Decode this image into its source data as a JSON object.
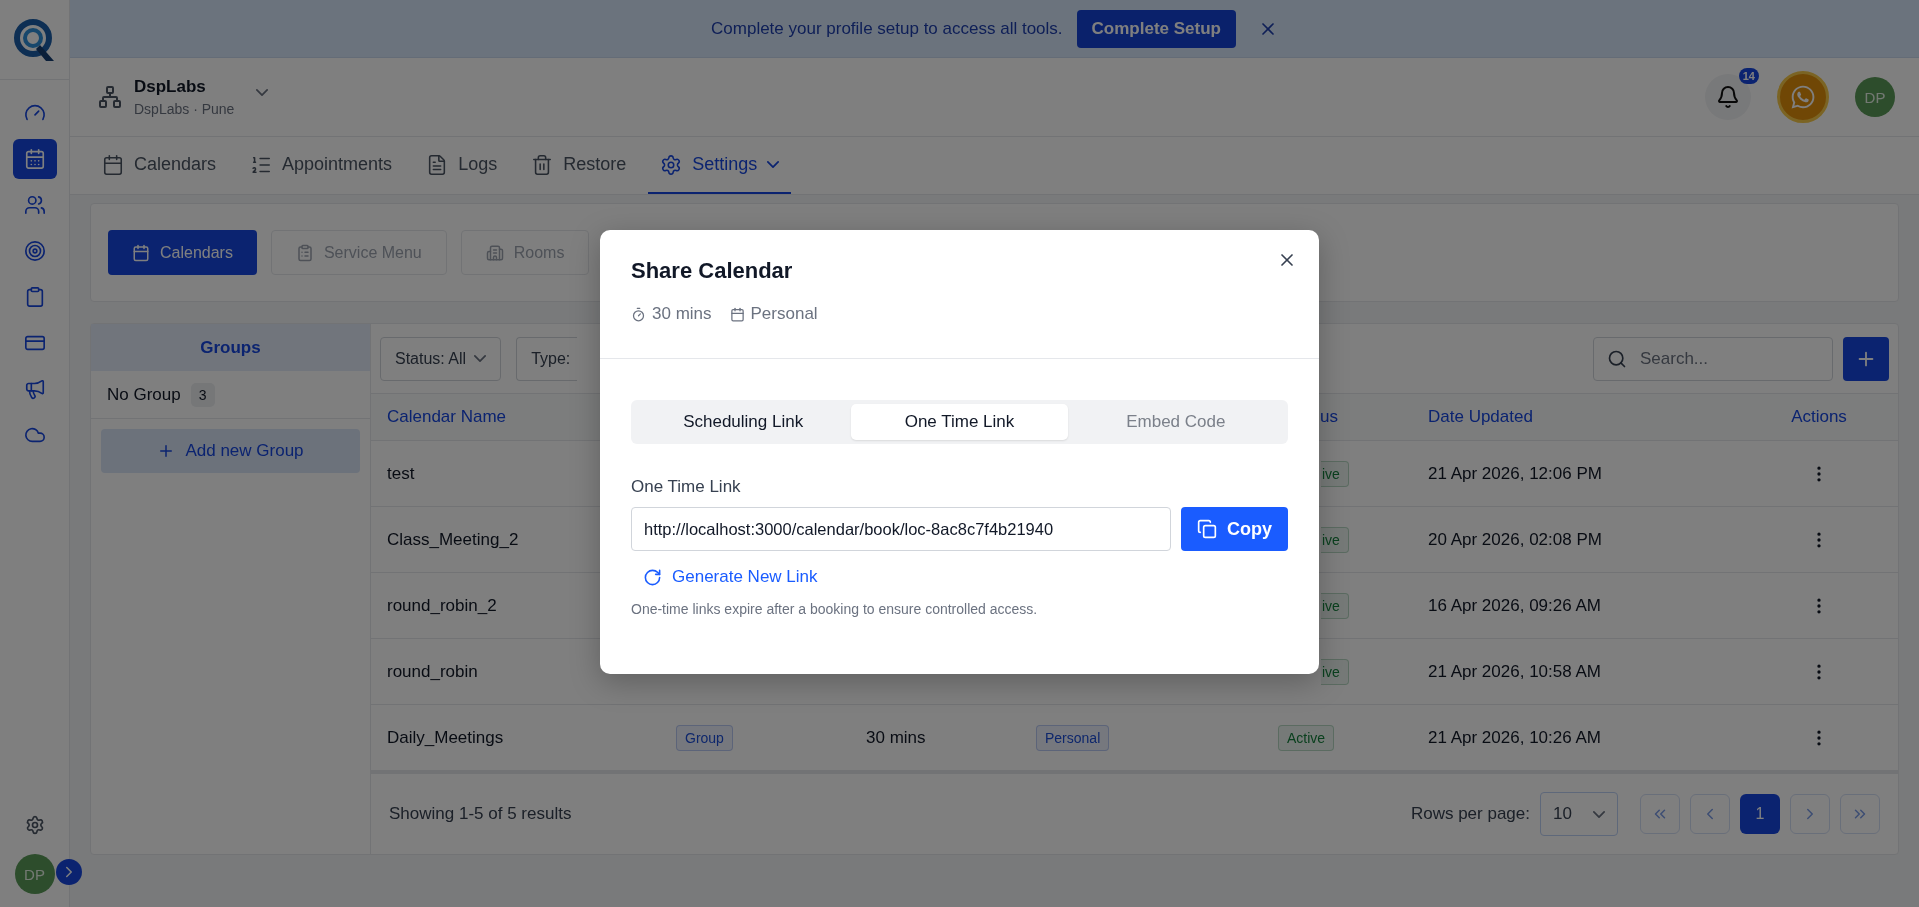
{
  "banner": {
    "message": "Complete your profile setup to access all tools.",
    "button": "Complete Setup"
  },
  "sidebar": {
    "items": [
      {
        "selected": false
      },
      {
        "selected": true
      },
      {
        "selected": false
      },
      {
        "selected": false
      },
      {
        "selected": false
      },
      {
        "selected": false
      },
      {
        "selected": false
      },
      {
        "selected": false
      }
    ],
    "avatar": "DP"
  },
  "org": {
    "name": "DspLabs",
    "location": "DspLabs · Pune"
  },
  "header": {
    "notifications": "14",
    "avatar": "DP"
  },
  "nav_tabs": [
    {
      "label": "Calendars",
      "selected": false
    },
    {
      "label": "Appointments",
      "selected": false
    },
    {
      "label": "Logs",
      "selected": false
    },
    {
      "label": "Restore",
      "selected": false
    },
    {
      "label": "Settings",
      "selected": true
    }
  ],
  "sub_tabs": [
    {
      "label": "Calendars",
      "selected": true
    },
    {
      "label": "Service Menu",
      "selected": false
    },
    {
      "label": "Rooms",
      "selected": false
    }
  ],
  "groups": {
    "title": "Groups",
    "items": [
      {
        "label": "No Group",
        "count": "3"
      }
    ],
    "add_button": "Add new Group"
  },
  "filters": [
    {
      "label": "Status: All"
    },
    {
      "label": "Type:"
    }
  ],
  "search": {
    "placeholder": "Search..."
  },
  "table": {
    "columns": {
      "name": "Calendar Name",
      "status": "us",
      "updated": "Date Updated",
      "actions": "Actions"
    },
    "rows": [
      {
        "kind": "covered",
        "name": "test",
        "status": "ive",
        "updated": "21 Apr 2026, 12:06 PM"
      },
      {
        "kind": "covered",
        "name": "Class_Meeting_2",
        "status": "ive",
        "updated": "20 Apr 2026, 02:08 PM"
      },
      {
        "kind": "covered",
        "name": "round_robin_2",
        "status": "ive",
        "updated": "16 Apr 2026, 09:26 AM"
      },
      {
        "kind": "covered",
        "name": "round_robin",
        "status": "ive",
        "updated": "21 Apr 2026, 10:58 AM"
      },
      {
        "kind": "full",
        "name": "Daily_Meetings",
        "type": "Group",
        "duration": "30 mins",
        "category": "Personal",
        "status": "Active",
        "updated": "21 Apr 2026, 10:26 AM"
      }
    ]
  },
  "footer": {
    "summary": "Showing 1-5 of 5 results",
    "rows_label": "Rows per page:",
    "rows_value": "10",
    "pages": [
      {
        "label": "1",
        "selected": true
      }
    ]
  },
  "modal": {
    "title": "Share Calendar",
    "meta": [
      "30 mins",
      "Personal"
    ],
    "tabs": [
      {
        "label": "Scheduling Link",
        "selected": false,
        "disabled": false
      },
      {
        "label": "One Time Link",
        "selected": true,
        "disabled": false
      },
      {
        "label": "Embed Code",
        "selected": false,
        "disabled": true
      }
    ],
    "link_label": "One Time Link",
    "link_value": "http://localhost:3000/calendar/book/loc-8ac8c7f4b21940",
    "copy_button": "Copy",
    "generate_button": "Generate New Link",
    "note": "One-time links expire after a booking to ensure controlled access."
  }
}
